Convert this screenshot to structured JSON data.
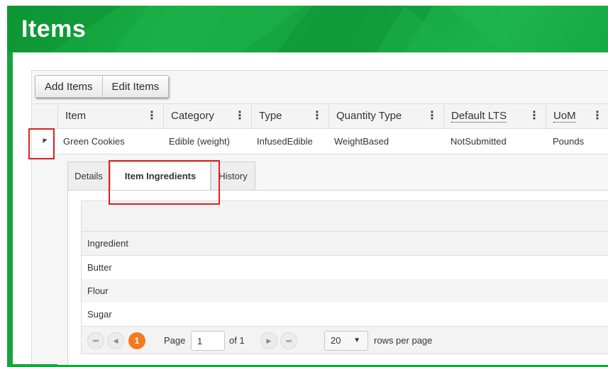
{
  "page": {
    "title": "Items"
  },
  "toolbar": {
    "add_label": "Add Items",
    "edit_label": "Edit Items"
  },
  "grid": {
    "columns": [
      {
        "label": "Item"
      },
      {
        "label": "Category"
      },
      {
        "label": "Type"
      },
      {
        "label": "Quantity Type"
      },
      {
        "label": "Default LTS"
      },
      {
        "label": "UoM"
      }
    ],
    "column_menu_glyph": "⋮",
    "rows": [
      {
        "item": "Green Cookies",
        "category": "Edible (weight)",
        "type": "InfusedEdible",
        "quantity_type": "WeightBased",
        "default_lts": "NotSubmitted",
        "uom": "Pounds"
      }
    ]
  },
  "detail": {
    "tabs": [
      {
        "label": "Details"
      },
      {
        "label": "Item Ingredients",
        "active": true
      },
      {
        "label": "History"
      }
    ],
    "ingredients": {
      "header": "Ingredient",
      "rows": [
        "Butter",
        "Flour",
        "Sugar"
      ]
    },
    "pager": {
      "first_icon": "⏮",
      "prev_icon": "◀",
      "current_page": "1",
      "page_label": "Page",
      "page_input": "1",
      "of_label": "of 1",
      "next_icon": "▶",
      "last_icon": "⏭",
      "page_size": "20",
      "page_size_caret": "▼",
      "rows_per_page_label": "rows per page"
    }
  },
  "colors": {
    "brand_green": "#17a43d",
    "accent_orange": "#f47a20",
    "highlight_red": "#e02020"
  }
}
